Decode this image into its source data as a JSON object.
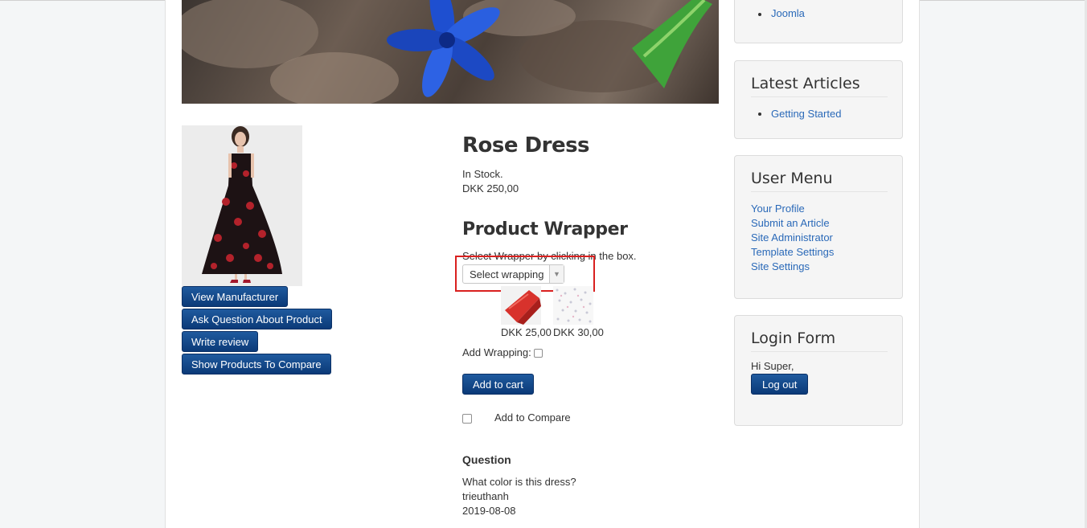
{
  "banner": {
    "alt": "flower banner"
  },
  "product": {
    "title": "Rose Dress",
    "stock": "In Stock.",
    "price": "DKK 250,00"
  },
  "left_buttons": {
    "view_manufacturer": "View Manufacturer",
    "ask_question": "Ask Question About Product",
    "write_review": "Write review",
    "show_compare": "Show Products To Compare"
  },
  "wrapper": {
    "heading": "Product Wrapper",
    "hint": "Select Wrapper by clicking in the box.",
    "select_value": "Select wrapping",
    "options": [
      {
        "price": "DKK 25,00"
      },
      {
        "price": "DKK 30,00"
      }
    ],
    "add_wrapping_label": "Add Wrapping:"
  },
  "actions": {
    "add_to_cart": "Add to cart",
    "add_to_compare": "Add to Compare"
  },
  "question": {
    "heading": "Question",
    "text": "What color is this dress?",
    "user": "trieuthanh",
    "date": "2019-08-08"
  },
  "sidebar": {
    "top_list": [
      "Joomla"
    ],
    "latest_articles": {
      "title": "Latest Articles",
      "items": [
        "Getting Started"
      ]
    },
    "user_menu": {
      "title": "User Menu",
      "items": [
        "Your Profile",
        "Submit an Article",
        "Site Administrator",
        "Template Settings",
        "Site Settings"
      ]
    },
    "login": {
      "title": "Login Form",
      "greeting": "Hi Super,",
      "logout": "Log out"
    }
  },
  "colors": {
    "accent": "#0b3a78",
    "link": "#2a69b8",
    "highlight": "#d9201f"
  }
}
